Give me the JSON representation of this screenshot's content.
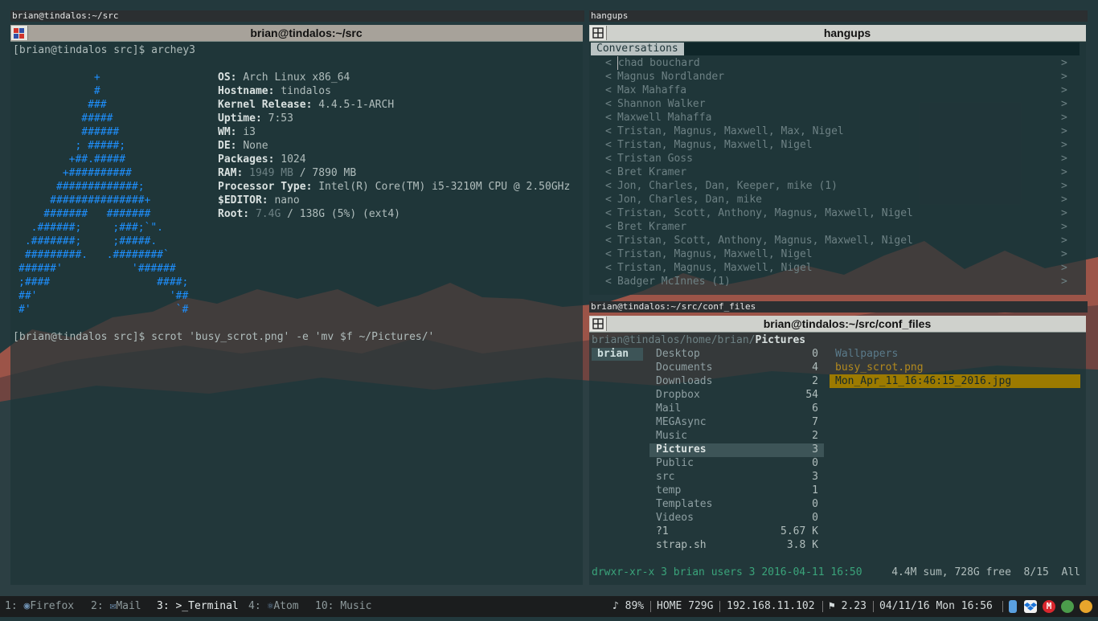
{
  "colors": {
    "accent_blue": "#1e90ff",
    "selection": "#3d5457",
    "highlight_file": "#9c7a00"
  },
  "left_window": {
    "i3_title": "brian@tindalos:~/src",
    "title": "brian@tindalos:~/src",
    "prompt1": "[brian@tindalos src]$ archey3",
    "logo": [
      "            +",
      "            #",
      "           ###",
      "          #####",
      "          ######",
      "         ; #####;",
      "        +##.#####",
      "       +##########",
      "      #############;",
      "     ###############+",
      "    #######   #######",
      "  .######;     ;###;`\".",
      " .#######;     ;#####.",
      " #########.   .########`",
      "######'           '######",
      ";####                 ####;",
      "##'                     '##",
      "#'                       `#"
    ],
    "info": [
      {
        "key": "OS:",
        "value": "Arch Linux x86_64"
      },
      {
        "key": "Hostname:",
        "value": "tindalos"
      },
      {
        "key": "Kernel Release:",
        "value": "4.4.5-1-ARCH"
      },
      {
        "key": "Uptime:",
        "value": "7:53"
      },
      {
        "key": "WM:",
        "value": "i3"
      },
      {
        "key": "DE:",
        "value": "None"
      },
      {
        "key": "Packages:",
        "value": "1024"
      },
      {
        "key": "RAM:",
        "value_dim": "1949 MB",
        "value": "/ 7890 MB"
      },
      {
        "key": "Processor Type:",
        "value": "Intel(R) Core(TM) i5-3210M CPU @ 2.50GHz"
      },
      {
        "key": "$EDITOR:",
        "value": "nano"
      },
      {
        "key": "Root:",
        "value_dim": "7.4G",
        "value": "/ 138G (5%) (ext4)"
      }
    ],
    "prompt2": "[brian@tindalos src]$ scrot 'busy_scrot.png' -e 'mv $f ~/Pictures/'"
  },
  "hangups_window": {
    "i3_title": "hangups",
    "title": "hangups",
    "tab": "Conversations",
    "conversations": [
      "chad bouchard",
      "Magnus Nordlander",
      "Max Mahaffa",
      "Shannon Walker",
      "Maxwell Mahaffa",
      "Tristan, Magnus, Maxwell, Max, Nigel",
      "Tristan, Magnus, Maxwell, Nigel",
      "Tristan Goss",
      "Bret Kramer",
      "Jon, Charles, Dan, Keeper, mike (1)",
      "Jon, Charles, Dan, mike",
      "Tristan, Scott, Anthony, Magnus, Maxwell, Nigel",
      "Bret Kramer",
      "Tristan, Scott, Anthony, Magnus, Maxwell, Nigel",
      "Tristan, Magnus, Maxwell, Nigel",
      "Tristan, Magnus, Maxwell, Nigel",
      "Badger McInnes (1)"
    ]
  },
  "ranger_window": {
    "i3_title": "brian@tindalos:~/src/conf_files",
    "title": "brian@tindalos:~/src/conf_files",
    "path_user": "brian@tindalos",
    "path_dir": "/home/brian/",
    "path_current": "Pictures",
    "parent_col": [
      "brian"
    ],
    "dirs": [
      {
        "name": "Desktop",
        "count": "0"
      },
      {
        "name": "Documents",
        "count": "4"
      },
      {
        "name": "Downloads",
        "count": "2"
      },
      {
        "name": "Dropbox",
        "count": "54"
      },
      {
        "name": "Mail",
        "count": "6"
      },
      {
        "name": "MEGAsync",
        "count": "7"
      },
      {
        "name": "Music",
        "count": "2"
      },
      {
        "name": "Pictures",
        "count": "3"
      },
      {
        "name": "Public",
        "count": "0"
      },
      {
        "name": "src",
        "count": "3"
      },
      {
        "name": "temp",
        "count": "1"
      },
      {
        "name": "Templates",
        "count": "0"
      },
      {
        "name": "Videos",
        "count": "0"
      },
      {
        "name": "?1",
        "count": "5.67 K"
      },
      {
        "name": "strap.sh",
        "count": "3.8 K"
      }
    ],
    "preview": [
      "Wallpapers",
      "busy_scrot.png",
      "Mon_Apr_11_16:46:15_2016.jpg"
    ],
    "status_left": "drwxr-xr-x 3 brian users 3 2016-04-11 16:50",
    "status_right": "4.4M sum, 728G free  8/15  All"
  },
  "bar": {
    "workspaces": [
      {
        "num": "1:",
        "label": "Firefox",
        "icon": "firefox-icon"
      },
      {
        "num": "2:",
        "label": "Mail",
        "icon": "mail-icon"
      },
      {
        "num": "3:",
        "label": ">_Terminal",
        "icon": "terminal-icon"
      },
      {
        "num": "4:",
        "label": "Atom",
        "icon": "atom-icon"
      },
      {
        "num": "10:",
        "label": "Music",
        "icon": "music-icon"
      }
    ],
    "status": {
      "volume": "♪ 89%",
      "home": "HOME 729G",
      "ip": "192.168.11.102",
      "load": "⚑ 2.23",
      "datetime": "04/11/16 Mon 16:56"
    }
  }
}
